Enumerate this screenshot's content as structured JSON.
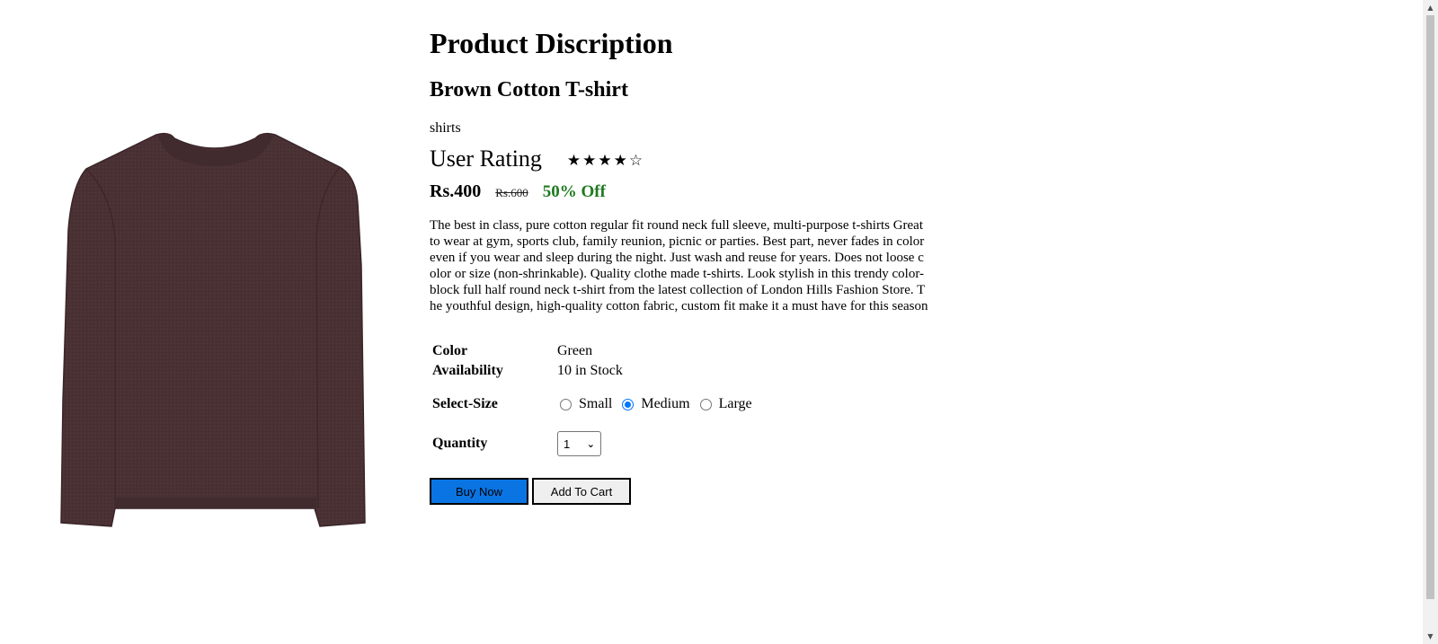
{
  "page": {
    "title": "Product Discription"
  },
  "product": {
    "name": "Brown Cotton T-shirt",
    "category": "shirts",
    "rating_label": "User Rating",
    "rating": 4,
    "rating_max": 5,
    "price": "Rs.400",
    "old_price": "Rs.600",
    "discount": "50% Off",
    "description": "The best in class, pure cotton regular fit round neck full sleeve, multi-purpose t-shirts Great to wear at gym, sports club, family reunion, picnic or parties. Best part, never fades in color even if you wear and sleep during the night. Just wash and reuse for years. Does not loose color or size (non-shrinkable). Quality clothe made t-shirts. Look stylish in this trendy color-block full half round neck t-shirt from the latest collection of London Hills Fashion Store. The youthful design, high-quality cotton fabric, custom fit make it a must have for this season",
    "color_label": "Color",
    "color_value": "Green",
    "availability_label": "Availability",
    "availability_value": "10 in Stock",
    "image_color": "#4a3134"
  },
  "size": {
    "label": "Select-Size",
    "options": [
      "Small",
      "Medium",
      "Large"
    ],
    "selected": "Medium"
  },
  "quantity": {
    "label": "Quantity",
    "value": "1"
  },
  "buttons": {
    "buy_now": "Buy Now",
    "add_to_cart": "Add To Cart"
  },
  "colors": {
    "buy_button": "#0a74e3",
    "discount": "#1f7a1f",
    "radio_accent": "#0075ff"
  },
  "icons": {
    "star_filled": "star-filled-icon",
    "star_empty": "star-empty-icon",
    "dropdown": "chevron-down-icon"
  }
}
